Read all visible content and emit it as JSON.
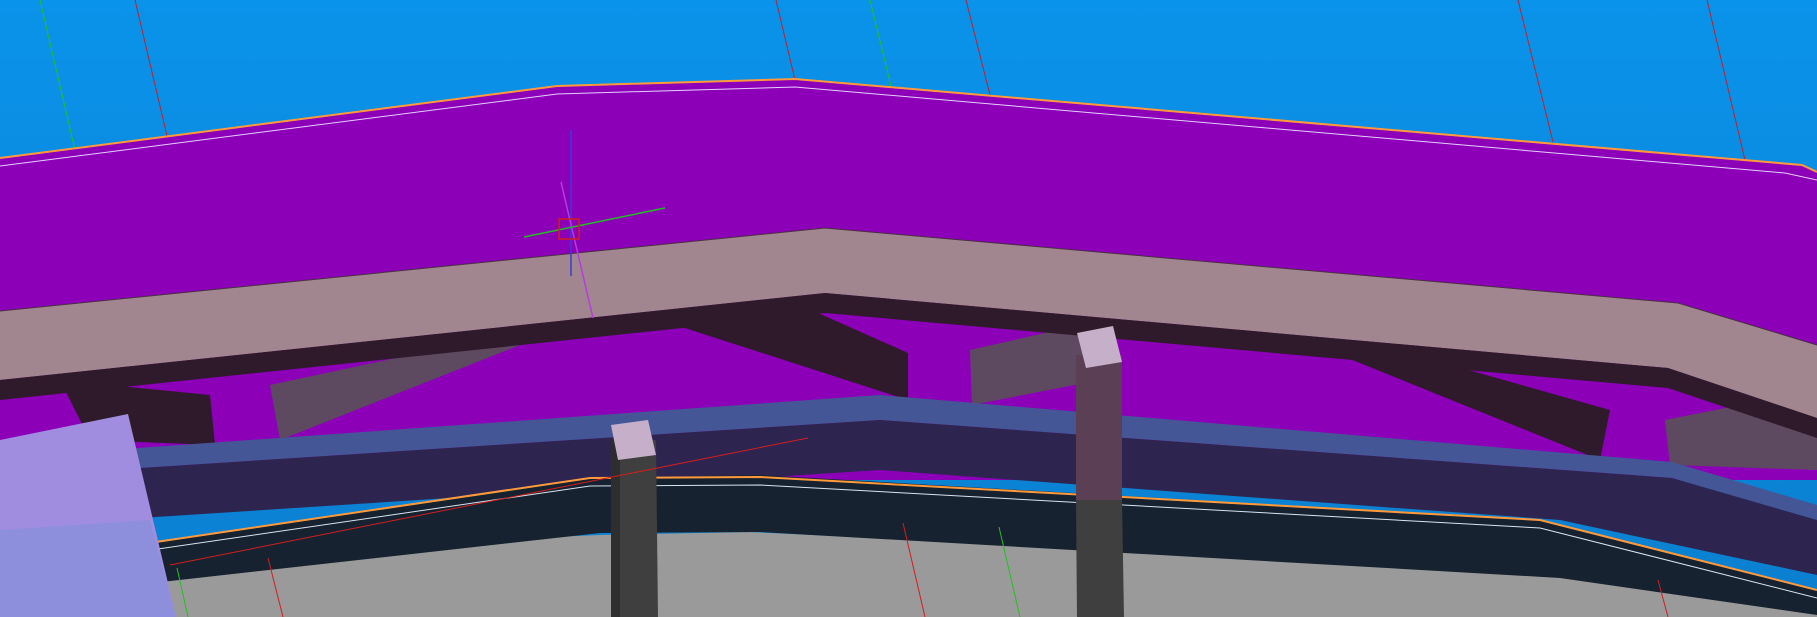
{
  "app": {
    "view": "3d-model-viewport"
  },
  "colors": {
    "sky_top": "#0a93ea",
    "sky_bottom": "#0b7fcf",
    "roof_surface": "#8c00b8",
    "fascia_beam": "#a2868f",
    "beam_shadow": "#2f1a2b",
    "lower_beam": "#455696",
    "lower_beam_face": "#2d2550",
    "floor_edge": "#16222f",
    "ground": "#9a9a9a",
    "column": "#3f3f3f",
    "column_cap": "#c6b0c9",
    "panel": "#a08de0",
    "edge_highlight": "#ff9a3c",
    "axis_x": "#d21e1e",
    "axis_y": "#22c022",
    "axis_z": "#3a3ad8"
  },
  "icons": {
    "gizmo": "transform-gizmo-icon"
  }
}
